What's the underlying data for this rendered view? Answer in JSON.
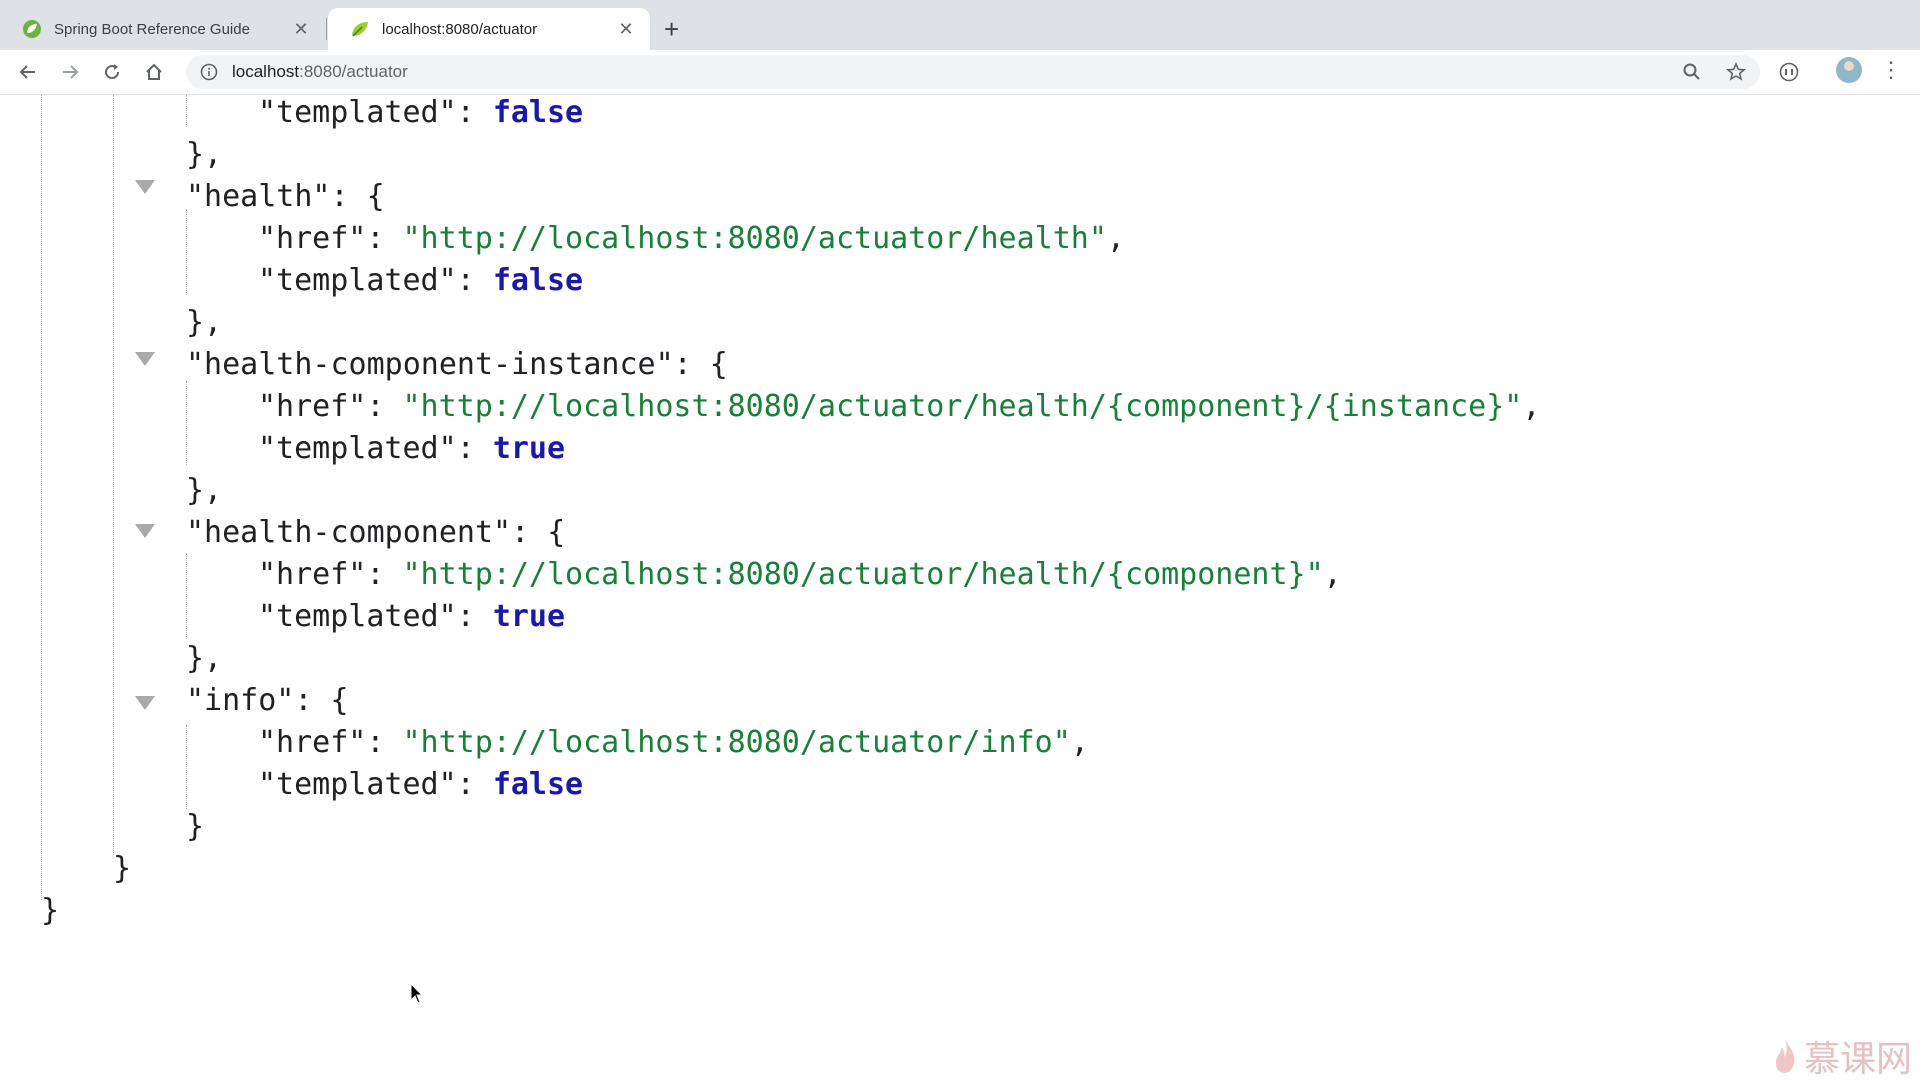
{
  "browser": {
    "tabs": [
      {
        "title": "Spring Boot Reference Guide",
        "close": "✕"
      },
      {
        "title": "localhost:8080/actuator",
        "close": "✕"
      }
    ],
    "new_tab_glyph": "+",
    "address": {
      "host": "localhost",
      "rest": ":8080/actuator"
    },
    "icons": [
      "back-icon",
      "forward-icon",
      "reload-icon",
      "home-icon",
      "info-icon",
      "zoom-icon",
      "star-icon",
      "extension-icon",
      "avatar",
      "menu-icon"
    ]
  },
  "json": {
    "lines": [
      {
        "parts": [
          {
            "t": "\"templated\": ",
            "c": "p"
          },
          {
            "t": "false",
            "c": "kw"
          }
        ]
      },
      {
        "parts": [
          {
            "t": "},",
            "c": "p"
          }
        ]
      },
      {
        "parts": [
          {
            "t": "\"health\": {",
            "c": "p"
          }
        ]
      },
      {
        "parts": [
          {
            "t": "\"href\": ",
            "c": "p"
          },
          {
            "t": "\"http://localhost:8080/actuator/health\"",
            "c": "str"
          },
          {
            "t": ",",
            "c": "p"
          }
        ]
      },
      {
        "parts": [
          {
            "t": "\"templated\": ",
            "c": "p"
          },
          {
            "t": "false",
            "c": "kw"
          }
        ]
      },
      {
        "parts": [
          {
            "t": "},",
            "c": "p"
          }
        ]
      },
      {
        "parts": [
          {
            "t": "\"health-component-instance\": {",
            "c": "p"
          }
        ]
      },
      {
        "parts": [
          {
            "t": "\"href\": ",
            "c": "p"
          },
          {
            "t": "\"http://localhost:8080/actuator/health/{component}/{instance}\"",
            "c": "str"
          },
          {
            "t": ",",
            "c": "p"
          }
        ]
      },
      {
        "parts": [
          {
            "t": "\"templated\": ",
            "c": "p"
          },
          {
            "t": "true",
            "c": "kw"
          }
        ]
      },
      {
        "parts": [
          {
            "t": "},",
            "c": "p"
          }
        ]
      },
      {
        "parts": [
          {
            "t": "\"health-component\": {",
            "c": "p"
          }
        ]
      },
      {
        "parts": [
          {
            "t": "\"href\": ",
            "c": "p"
          },
          {
            "t": "\"http://localhost:8080/actuator/health/{component}\"",
            "c": "str"
          },
          {
            "t": ",",
            "c": "p"
          }
        ]
      },
      {
        "parts": [
          {
            "t": "\"templated\": ",
            "c": "p"
          },
          {
            "t": "true",
            "c": "kw"
          }
        ]
      },
      {
        "parts": [
          {
            "t": "},",
            "c": "p"
          }
        ]
      },
      {
        "parts": [
          {
            "t": "\"info\": {",
            "c": "p"
          }
        ]
      },
      {
        "parts": [
          {
            "t": "\"href\": ",
            "c": "p"
          },
          {
            "t": "\"http://localhost:8080/actuator/info\"",
            "c": "str"
          },
          {
            "t": ",",
            "c": "p"
          }
        ]
      },
      {
        "parts": [
          {
            "t": "\"templated\": ",
            "c": "p"
          },
          {
            "t": "false",
            "c": "kw"
          }
        ]
      },
      {
        "parts": [
          {
            "t": "}",
            "c": "p"
          }
        ]
      },
      {
        "parts": [
          {
            "t": "}",
            "c": "p"
          }
        ]
      },
      {
        "parts": [
          {
            "t": "}",
            "c": "p"
          }
        ]
      }
    ]
  },
  "watermark": {
    "text": "慕课网",
    "color": "#e7c0c0"
  },
  "colors": {
    "string": "#188038",
    "keyword": "#1a1aa6",
    "plain": "#202124"
  }
}
